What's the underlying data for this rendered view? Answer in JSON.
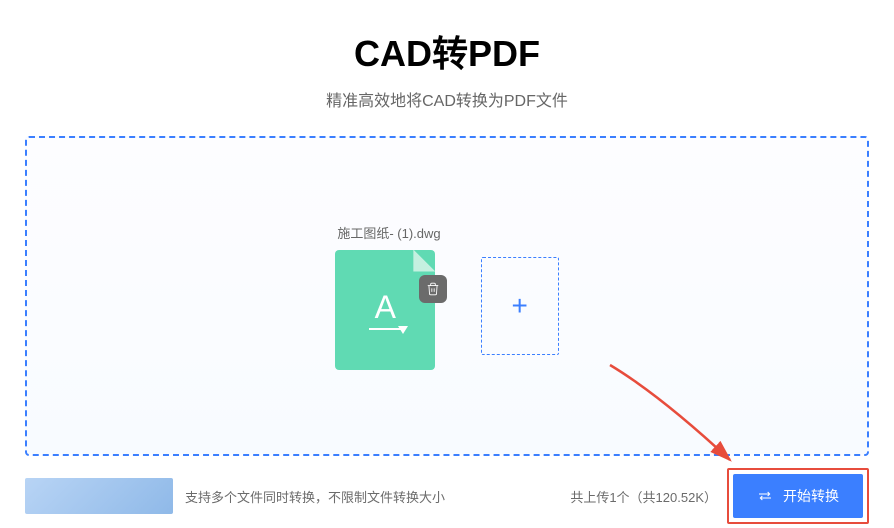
{
  "header": {
    "title": "CAD转PDF",
    "subtitle": "精准高效地将CAD转换为PDF文件"
  },
  "file": {
    "name": "施工图纸- (1).dwg",
    "icon_letter": "A"
  },
  "footer": {
    "support_text": "支持多个文件同时转换，不限制文件转换大小",
    "stats": "共上传1个（共120.52K）",
    "convert_label": "开始转换"
  }
}
